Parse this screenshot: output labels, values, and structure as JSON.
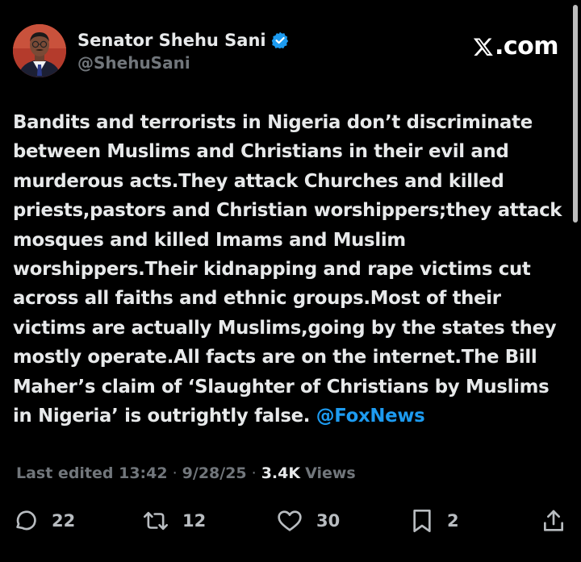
{
  "author": {
    "display_name": "Senator Shehu Sani",
    "handle": "@ShehuSani",
    "verified": true,
    "avatar_icon": "profile-photo"
  },
  "brand": {
    "label": ".com",
    "logo_icon": "x-logo-icon"
  },
  "tweet": {
    "body": "Bandits and terrorists in Nigeria don’t discriminate between Muslims and Christians in their evil and murderous acts.They attack Churches and killed priests,pastors and Christian worshippers;they attack mosques and killed Imams and Muslim worshippers.Their kidnapping and rape victims cut across all faiths and ethnic groups.Most of their victims are actually Muslims,going by the states they mostly operate.All facts are on the internet.The Bill Maher’s claim of ‘Slaughter of Christians by Muslims in Nigeria’ is outrightly false.",
    "mention": "@FoxNews"
  },
  "meta": {
    "edited": "Last edited 13:42",
    "separator": "·",
    "date": "9/28/25",
    "views_count": "3.4K",
    "views_label": "Views"
  },
  "actions": {
    "replies": "22",
    "reposts": "12",
    "likes": "30",
    "bookmarks": "2"
  },
  "colors": {
    "background": "#000000",
    "text": "#e7e9ea",
    "secondary": "#71767b",
    "accent": "#1d9bf0"
  }
}
